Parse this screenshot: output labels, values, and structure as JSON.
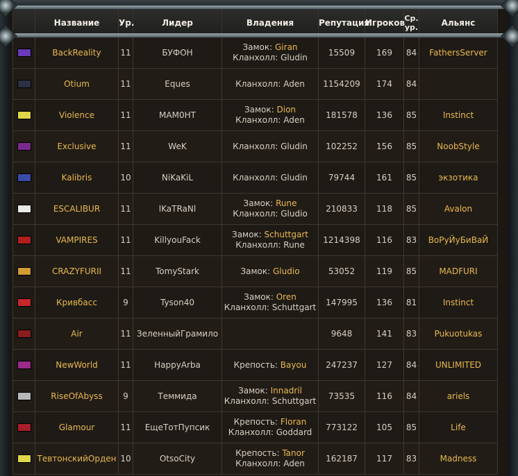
{
  "columns": [
    "",
    "Название",
    "Ур.",
    "Лидер",
    "Владения",
    "Репутация",
    "Игроков",
    "Ср. ур.",
    "Альянс"
  ],
  "rows": [
    {
      "crest": "#6a3bb8",
      "name": "BackReality",
      "level": "11",
      "leader": "БУФОН",
      "holdings": [
        {
          "label": "Замок: ",
          "value": "Giran"
        },
        {
          "label": "Кланхолл: Gludin",
          "value": ""
        }
      ],
      "reputation": "15509",
      "players": "169",
      "avg": "84",
      "alliance": "FathersServer"
    },
    {
      "crest": "#2a3140",
      "name": "Otium",
      "level": "11",
      "leader": "Eques",
      "holdings": [
        {
          "label": "Кланхолл: Aden",
          "value": ""
        }
      ],
      "reputation": "1154209",
      "players": "174",
      "avg": "84",
      "alliance": ""
    },
    {
      "crest": "#e0d64a",
      "name": "Violence",
      "level": "11",
      "leader": "MAM0HT",
      "holdings": [
        {
          "label": "Замок: ",
          "value": "Dion"
        },
        {
          "label": "Кланхолл: Aden",
          "value": ""
        }
      ],
      "reputation": "181578",
      "players": "136",
      "avg": "85",
      "alliance": "Instinct"
    },
    {
      "crest": "#7a2a8c",
      "name": "Exclusive",
      "level": "11",
      "leader": "WeK",
      "holdings": [
        {
          "label": "Кланхолл: Gludin",
          "value": ""
        }
      ],
      "reputation": "102252",
      "players": "156",
      "avg": "85",
      "alliance": "NoobStyle"
    },
    {
      "crest": "#3a4aa8",
      "name": "Kalibris",
      "level": "10",
      "leader": "NiKaKiL",
      "holdings": [
        {
          "label": "Кланхолл: Gludin",
          "value": ""
        }
      ],
      "reputation": "79744",
      "players": "161",
      "avg": "85",
      "alliance": "экзотика"
    },
    {
      "crest": "#e8e8e8",
      "name": "ESCALIBUR",
      "level": "11",
      "leader": "lKaTRaNl",
      "holdings": [
        {
          "label": "Замок: ",
          "value": "Rune"
        },
        {
          "label": "Кланхолл: Gludio",
          "value": ""
        }
      ],
      "reputation": "210833",
      "players": "118",
      "avg": "85",
      "alliance": "Avalon"
    },
    {
      "crest": "#b01e1e",
      "name": "VAMPIRES",
      "level": "11",
      "leader": "KillyouFack",
      "holdings": [
        {
          "label": "Замок: ",
          "value": "Schuttgart"
        },
        {
          "label": "Кланхолл: Rune",
          "value": ""
        }
      ],
      "reputation": "1214398",
      "players": "116",
      "avg": "83",
      "alliance": "ВоРуЙуБиВаЙ"
    },
    {
      "crest": "#d09a34",
      "name": "CRAZYFURII",
      "level": "11",
      "leader": "TomyStark",
      "holdings": [
        {
          "label": "Замок: ",
          "value": "Gludio"
        }
      ],
      "reputation": "53052",
      "players": "119",
      "avg": "85",
      "alliance": "MADFURI"
    },
    {
      "crest": "#c42828",
      "name": "Кривбасс",
      "level": "9",
      "leader": "Tyson40",
      "holdings": [
        {
          "label": "Замок: ",
          "value": "Oren"
        },
        {
          "label": "Кланхолл: Schuttgart",
          "value": ""
        }
      ],
      "reputation": "147995",
      "players": "136",
      "avg": "81",
      "alliance": "Instinct"
    },
    {
      "crest": "#8a1e1e",
      "name": "Air",
      "level": "11",
      "leader": "ЗеленныйГрамило",
      "holdings": [],
      "reputation": "9648",
      "players": "141",
      "avg": "83",
      "alliance": "Pukuotukas"
    },
    {
      "crest": "#9a2a8a",
      "name": "NewWorld",
      "level": "11",
      "leader": "HappyArba",
      "holdings": [
        {
          "label": "Крепость: ",
          "value": "Bayou"
        }
      ],
      "reputation": "247237",
      "players": "127",
      "avg": "84",
      "alliance": "UNLIMITED"
    },
    {
      "crest": "#b8b8b8",
      "name": "RiseOfAbyss",
      "level": "9",
      "leader": "Теммида",
      "holdings": [
        {
          "label": "Замок: ",
          "value": "Innadril"
        },
        {
          "label": "Кланхолл: Schuttgart",
          "value": ""
        }
      ],
      "reputation": "73535",
      "players": "116",
      "avg": "84",
      "alliance": "ariels"
    },
    {
      "crest": "#a81e2a",
      "name": "Glamour",
      "level": "11",
      "leader": "ЕщеТотПупсик",
      "holdings": [
        {
          "label": "Крепость: ",
          "value": "Floran"
        },
        {
          "label": "Кланхолл: Goddard",
          "value": ""
        }
      ],
      "reputation": "773122",
      "players": "105",
      "avg": "85",
      "alliance": "Life"
    },
    {
      "crest": "#e0d64a",
      "name": "ТевтонскийОрден",
      "level": "10",
      "leader": "OtsoCity",
      "holdings": [
        {
          "label": "Крепость: ",
          "value": "Tanor"
        },
        {
          "label": "Кланхолл: Aden",
          "value": ""
        }
      ],
      "reputation": "162187",
      "players": "117",
      "avg": "83",
      "alliance": "Madness"
    }
  ]
}
